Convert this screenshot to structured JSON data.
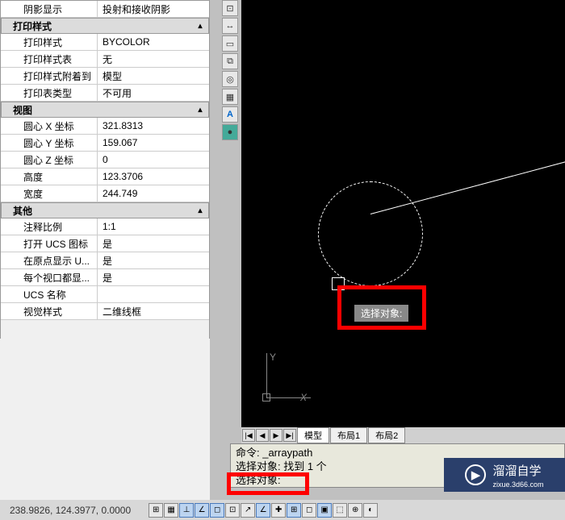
{
  "sections": {
    "shadow": {
      "label": "阴影显示",
      "value": "投射和接收阴影"
    },
    "printStyle": {
      "title": "打印样式",
      "rows": [
        {
          "label": "打印样式",
          "value": "BYCOLOR"
        },
        {
          "label": "打印样式表",
          "value": "无"
        },
        {
          "label": "打印样式附着到",
          "value": "模型"
        },
        {
          "label": "打印表类型",
          "value": "不可用"
        }
      ]
    },
    "view": {
      "title": "视图",
      "rows": [
        {
          "label": "圆心 X 坐标",
          "value": "321.8313"
        },
        {
          "label": "圆心 Y 坐标",
          "value": "159.067"
        },
        {
          "label": "圆心 Z 坐标",
          "value": "0"
        },
        {
          "label": "高度",
          "value": "123.3706"
        },
        {
          "label": "宽度",
          "value": "244.749"
        }
      ]
    },
    "misc": {
      "title": "其他",
      "rows": [
        {
          "label": "注释比例",
          "value": "1:1"
        },
        {
          "label": "打开 UCS 图标",
          "value": "是"
        },
        {
          "label": "在原点显示 U...",
          "value": "是"
        },
        {
          "label": "每个视口都显...",
          "value": "是"
        },
        {
          "label": "UCS 名称",
          "value": ""
        },
        {
          "label": "视觉样式",
          "value": "二维线框"
        }
      ]
    }
  },
  "viewport": {
    "ucs_x": "X",
    "ucs_y": "Y",
    "tooltip": "选择对象:"
  },
  "modelTabs": {
    "nav": [
      "|◀",
      "◀",
      "▶",
      "▶|"
    ],
    "tabs": [
      "模型",
      "布局1",
      "布局2"
    ]
  },
  "cmdline": {
    "l1": "命令: _arraypath",
    "l2": "选择对象: 找到 1 个",
    "l3": "选择对象:"
  },
  "status": {
    "coords": "238.9826, 124.3977, 0.0000"
  },
  "watermark": {
    "text": "溜溜自学",
    "sub": "zixue.3d66.com"
  }
}
